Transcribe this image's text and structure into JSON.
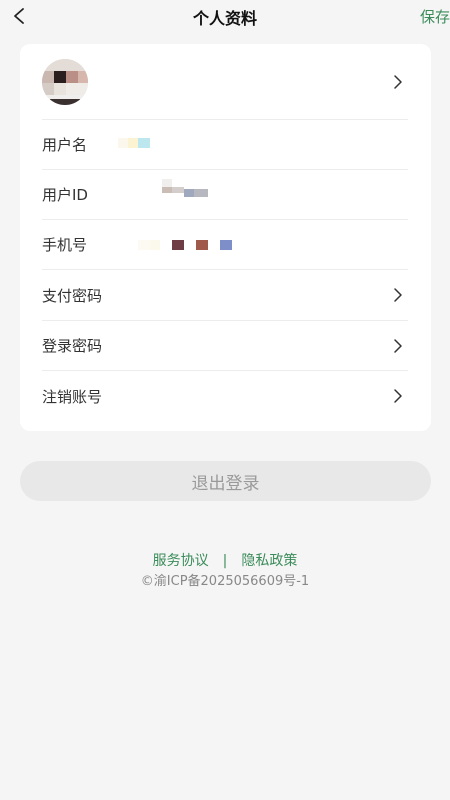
{
  "header": {
    "title": "个人资料",
    "save_label": "保存"
  },
  "profile": {
    "avatar_label": "",
    "rows": [
      {
        "label": "用户名"
      },
      {
        "label": "用户ID"
      },
      {
        "label": "手机号"
      },
      {
        "label": "支付密码"
      },
      {
        "label": "登录密码"
      },
      {
        "label": "注销账号"
      }
    ]
  },
  "logout_label": "退出登录",
  "footer": {
    "service_agreement": "服务协议",
    "separator": "|",
    "privacy_policy": "隐私政策",
    "icp": "©渝ICP备2025056609号-1"
  },
  "colors": {
    "accent": "#3b8c5a",
    "background": "#f5f5f5",
    "card": "#ffffff"
  }
}
